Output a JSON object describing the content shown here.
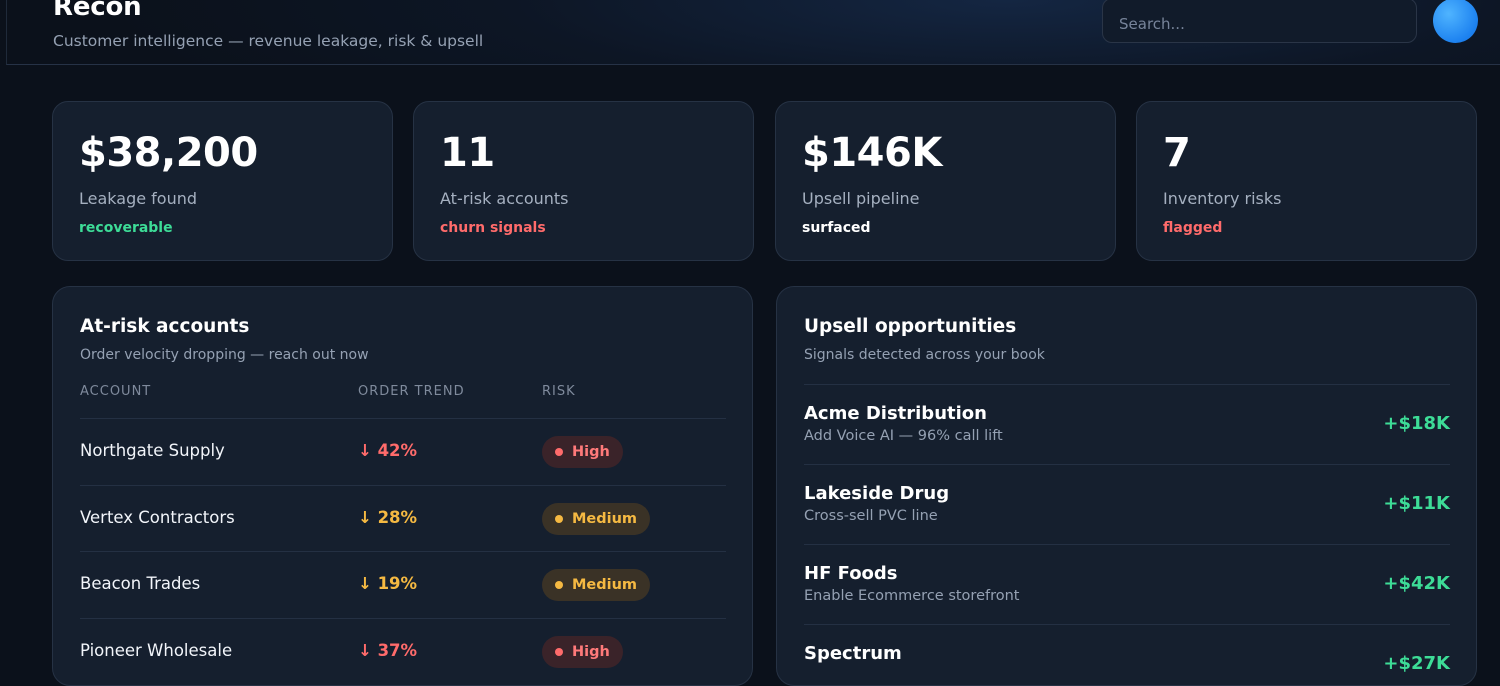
{
  "header": {
    "title": "Recon",
    "subtitle": "Customer intelligence — revenue leakage, risk & upsell",
    "search_placeholder": "Search..."
  },
  "colors": {
    "green": "#3ddc97",
    "red": "#ff6b6b",
    "amber": "#f5b942",
    "white": "#ffffff"
  },
  "stats": [
    {
      "value": "$38,200",
      "label": "Leakage found",
      "tag": "recoverable",
      "tag_color": "green"
    },
    {
      "value": "11",
      "label": "At-risk accounts",
      "tag": "churn signals",
      "tag_color": "red"
    },
    {
      "value": "$146K",
      "label": "Upsell pipeline",
      "tag": "surfaced",
      "tag_color": "white"
    },
    {
      "value": "7",
      "label": "Inventory risks",
      "tag": "flagged",
      "tag_color": "red"
    }
  ],
  "at_risk": {
    "title": "At-risk accounts",
    "subtitle": "Order velocity dropping — reach out now",
    "columns": [
      "ACCOUNT",
      "ORDER TREND",
      "RISK"
    ],
    "rows": [
      {
        "account": "Northgate Supply",
        "trend": "↓ 42%",
        "risk": "High",
        "level": "high"
      },
      {
        "account": "Vertex Contractors",
        "trend": "↓ 28%",
        "risk": "Medium",
        "level": "medium"
      },
      {
        "account": "Beacon Trades",
        "trend": "↓ 19%",
        "risk": "Medium",
        "level": "medium"
      },
      {
        "account": "Pioneer Wholesale",
        "trend": "↓ 37%",
        "risk": "High",
        "level": "high"
      }
    ]
  },
  "upsell": {
    "title": "Upsell opportunities",
    "subtitle": "Signals detected across your book",
    "items": [
      {
        "name": "Acme Distribution",
        "desc": "Add Voice AI — 96% call lift",
        "amount": "+$18K"
      },
      {
        "name": "Lakeside Drug",
        "desc": "Cross-sell PVC line",
        "amount": "+$11K"
      },
      {
        "name": "HF Foods",
        "desc": "Enable Ecommerce storefront",
        "amount": "+$42K"
      },
      {
        "name": "Spectrum",
        "desc": "",
        "amount": "+$27K"
      }
    ]
  }
}
